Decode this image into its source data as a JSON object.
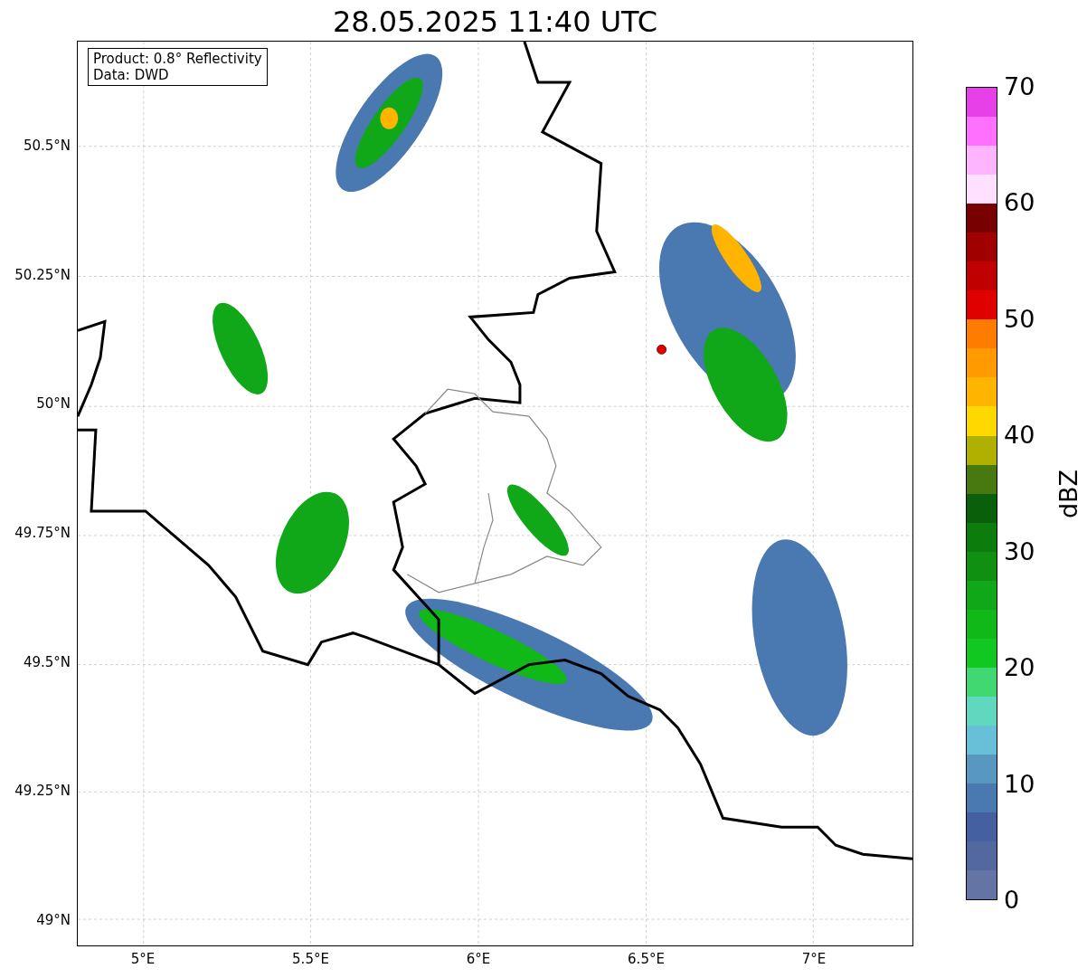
{
  "title": "28.05.2025 11:40 UTC",
  "info_box": {
    "lines": [
      "Product: 0.8° Reflectivity",
      "Data: DWD"
    ]
  },
  "y_ticks": [
    "50.5°N",
    "50.25°N",
    "50°N",
    "49.75°N",
    "49.5°N",
    "49.25°N",
    "49°N"
  ],
  "x_ticks": [
    "5°E",
    "5.5°E",
    "6°E",
    "6.5°E",
    "7°E"
  ],
  "colorbar": {
    "label": "dBZ",
    "ticks": [
      "70",
      "60",
      "50",
      "40",
      "30",
      "20",
      "10",
      "0"
    ],
    "bands": [
      {
        "color": "#6474a4"
      },
      {
        "color": "#5468a0"
      },
      {
        "color": "#4460a0"
      },
      {
        "color": "#4a78b0"
      },
      {
        "color": "#5898c0"
      },
      {
        "color": "#68c0d8"
      },
      {
        "color": "#60d8c0"
      },
      {
        "color": "#40d870"
      },
      {
        "color": "#10c820"
      },
      {
        "color": "#10b818"
      },
      {
        "color": "#10a818"
      },
      {
        "color": "#109010"
      },
      {
        "color": "#0c7c0c"
      },
      {
        "color": "#0a600a"
      },
      {
        "color": "#487810"
      },
      {
        "color": "#b0b000"
      },
      {
        "color": "#ffd800"
      },
      {
        "color": "#ffb400"
      },
      {
        "color": "#ff9a00"
      },
      {
        "color": "#ff7c00"
      },
      {
        "color": "#e00000"
      },
      {
        "color": "#c00000"
      },
      {
        "color": "#a00000"
      },
      {
        "color": "#780000"
      },
      {
        "color": "#ffe0ff"
      },
      {
        "color": "#ffb4ff"
      },
      {
        "color": "#ff70ff"
      },
      {
        "color": "#e840e8"
      }
    ]
  }
}
